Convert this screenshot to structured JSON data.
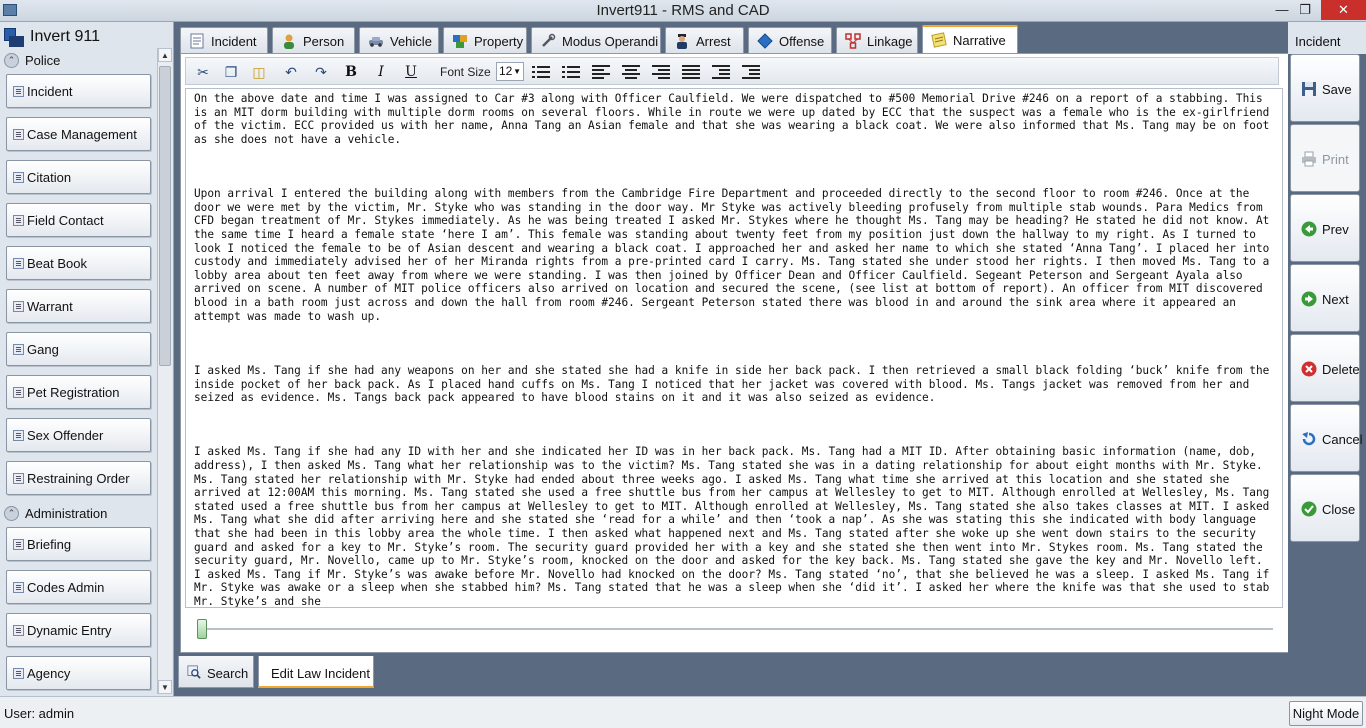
{
  "window": {
    "title": "Invert911 - RMS and CAD"
  },
  "brand": {
    "name": "Invert 911"
  },
  "sidebar": {
    "sections": [
      {
        "label": "Police"
      },
      {
        "label": "Administration"
      }
    ],
    "items": [
      {
        "label": "Incident"
      },
      {
        "label": "Case Management"
      },
      {
        "label": "Citation"
      },
      {
        "label": "Field Contact"
      },
      {
        "label": "Beat Book"
      },
      {
        "label": "Warrant"
      },
      {
        "label": "Gang"
      },
      {
        "label": "Pet Registration"
      },
      {
        "label": "Sex Offender"
      },
      {
        "label": "Restraining Order"
      },
      {
        "label": "Briefing"
      },
      {
        "label": "Codes Admin"
      },
      {
        "label": "Dynamic Entry"
      },
      {
        "label": "Agency"
      }
    ]
  },
  "tabs": [
    {
      "label": "Incident",
      "icon": "document-icon"
    },
    {
      "label": "Person",
      "icon": "person-icon"
    },
    {
      "label": "Vehicle",
      "icon": "car-icon"
    },
    {
      "label": "Property",
      "icon": "boxes-icon"
    },
    {
      "label": "Modus Operandi",
      "icon": "tools-icon"
    },
    {
      "label": "Arrest",
      "icon": "officer-icon"
    },
    {
      "label": "Offense",
      "icon": "badge-icon"
    },
    {
      "label": "Linkage",
      "icon": "link-icon"
    },
    {
      "label": "Narrative",
      "icon": "notes-icon",
      "active": true
    }
  ],
  "toolbar": {
    "font_size_label": "Font Size",
    "font_size_value": "12"
  },
  "narrative": {
    "paragraphs": [
      "On the above date and time I was assigned to Car #3 along with Officer Caulfield. We were dispatched to #500 Memorial Drive #246 on a report of a stabbing. This is an MIT dorm building with multiple dorm rooms on several floors. While in route we were up dated by ECC that the suspect was a female who is the ex-girlfriend of the victim. ECC provided us with her name, Anna Tang an Asian female and that she was wearing a black coat. We were also informed that Ms. Tang may be on foot as she does not have a vehicle.",
      "Upon arrival I entered the building along with members from the Cambridge Fire Department and proceeded directly to the second floor to room #246. Once at the door we were met by the victim, Mr. Styke who was standing in the door way. Mr Styke was actively bleeding profusely from multiple stab wounds. Para Medics from CFD began treatment of Mr. Stykes immediately. As he was being treated I asked Mr. Stykes where he thought Ms. Tang may be heading? He stated he did not know. At the same time I heard a female state ‘here I am’. This female was standing about twenty feet from my position just down the hallway to my right. As I turned to look I noticed the female to be of Asian descent and wearing a black coat. I approached her and asked her name to which she stated ‘Anna Tang’. I placed her into custody and immediately advised her of her Miranda rights from a pre-printed card I carry. Ms. Tang stated she under stood her rights. I then moved Ms. Tang to a lobby area about ten feet away from where we were standing. I was then joined by Officer Dean and Officer Caulfield. Segeant Peterson and Sergeant Ayala also arrived on scene. A number of MIT police officers also arrived on location and secured the scene, (see list at bottom of report). An officer from MIT discovered blood in a bath room just across and down the hall from room #246. Sergeant Peterson stated there was blood in and around the sink area where it appeared an attempt was made to wash up.",
      "I asked Ms. Tang if she had any weapons on her and she stated she had a knife in side her back pack. I then retrieved a small black folding ‘buck’ knife from the inside pocket of her back pack. As I placed hand cuffs on Ms. Tang I noticed that her jacket was covered with blood. Ms. Tangs jacket was removed from her and seized as evidence. Ms. Tangs back pack appeared to have blood stains on it and it was also seized as evidence.",
      "I asked Ms. Tang if she had any ID with her and she indicated her ID was in her back pack. Ms. Tang had a MIT ID. After obtaining basic information (name, dob, address), I then asked Ms. Tang what her relationship was to the victim? Ms. Tang stated she was in a dating relationship for about eight months with Mr. Styke. Ms. Tang stated her relationship with Mr. Styke had ended about three weeks ago. I asked Ms. Tang what time she arrived at this location and she stated she arrived at 12:00AM this morning. Ms. Tang stated she used a free shuttle bus from her campus at Wellesley to get to MIT. Although enrolled at Wellesley, Ms. Tang stated used a free shuttle bus from her campus at Wellesley to get to MIT. Although enrolled at Wellesley, Ms. Tang stated she also takes classes at MIT. I asked Ms. Tang what she did after arriving here and she stated she ‘read for a while’ and then ‘took a nap’. As she was stating this she indicated with body language that she had been in this lobby area the whole time. I then asked what happened next and Ms. Tang stated after she woke up she went down stairs to the security guard and asked for a key to Mr. Styke’s room. The security guard provided her with a key and she stated she then went into Mr. Stykes room. Ms. Tang stated the security guard, Mr. Novello, came up to Mr. Styke’s room, knocked on the door and asked for the key back. Ms. Tang stated she gave the key and Mr. Novello left. I asked Ms. Tang if Mr. Styke’s was awake before Mr. Novello had knocked on the door? Ms. Tang stated ‘no’, that she believed he was a sleep. I asked Ms. Tang if Mr. Styke was awake or a sleep when she stabbed him? Ms. Tang stated that he was a sleep when she ‘did it’. I asked her where the knife was that she used to stab Mr. Styke’s and she"
    ]
  },
  "actions": {
    "title": "Incident",
    "buttons": [
      {
        "label": "Save",
        "icon": "disk-icon",
        "color": "#3d5f8a"
      },
      {
        "label": "Print",
        "icon": "printer-icon",
        "color": "#9aa3ad",
        "disabled": true
      },
      {
        "label": "Prev",
        "icon": "arrow-left-icon",
        "color": "#3a9a3a"
      },
      {
        "label": "Next",
        "icon": "arrow-right-icon",
        "color": "#3a9a3a"
      },
      {
        "label": "Delete",
        "icon": "delete-icon",
        "color": "#d03030"
      },
      {
        "label": "Cancel",
        "icon": "undo-icon",
        "color": "#2a6fc4"
      },
      {
        "label": "Close",
        "icon": "check-icon",
        "color": "#3a9a3a"
      }
    ]
  },
  "bottom_tabs": [
    {
      "label": "Search"
    },
    {
      "label": "Edit Law Incident",
      "active": true
    }
  ],
  "status": {
    "user": "User: admin",
    "night_mode": "Night Mode"
  }
}
